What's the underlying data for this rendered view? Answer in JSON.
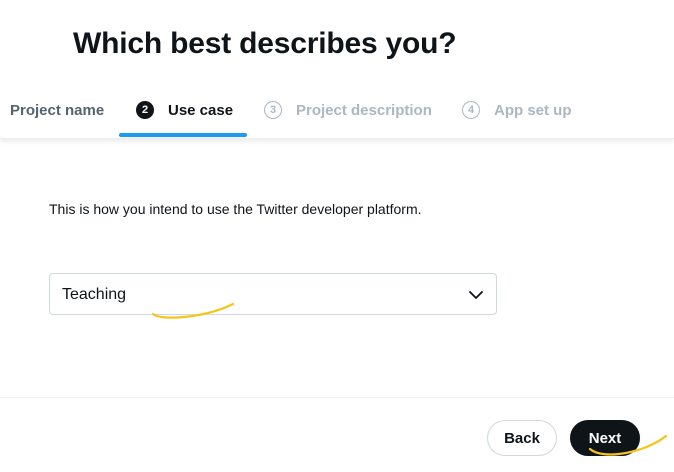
{
  "page": {
    "title": "Which best describes you?",
    "description": "This is how you intend to use the Twitter developer platform."
  },
  "stepper": {
    "steps": [
      {
        "number": "",
        "label": "Project name",
        "state": "completed"
      },
      {
        "number": "2",
        "label": "Use case",
        "state": "active"
      },
      {
        "number": "3",
        "label": "Project description",
        "state": "upcoming"
      },
      {
        "number": "4",
        "label": "App set up",
        "state": "upcoming"
      }
    ]
  },
  "use_case_select": {
    "selected_value": "Teaching",
    "icon": "chevron-down-icon"
  },
  "footer": {
    "back_label": "Back",
    "next_label": "Next"
  },
  "colors": {
    "accent": "#1d9bf0",
    "primary_button": "#0f1419",
    "annotation_highlight": "#f5c518"
  }
}
